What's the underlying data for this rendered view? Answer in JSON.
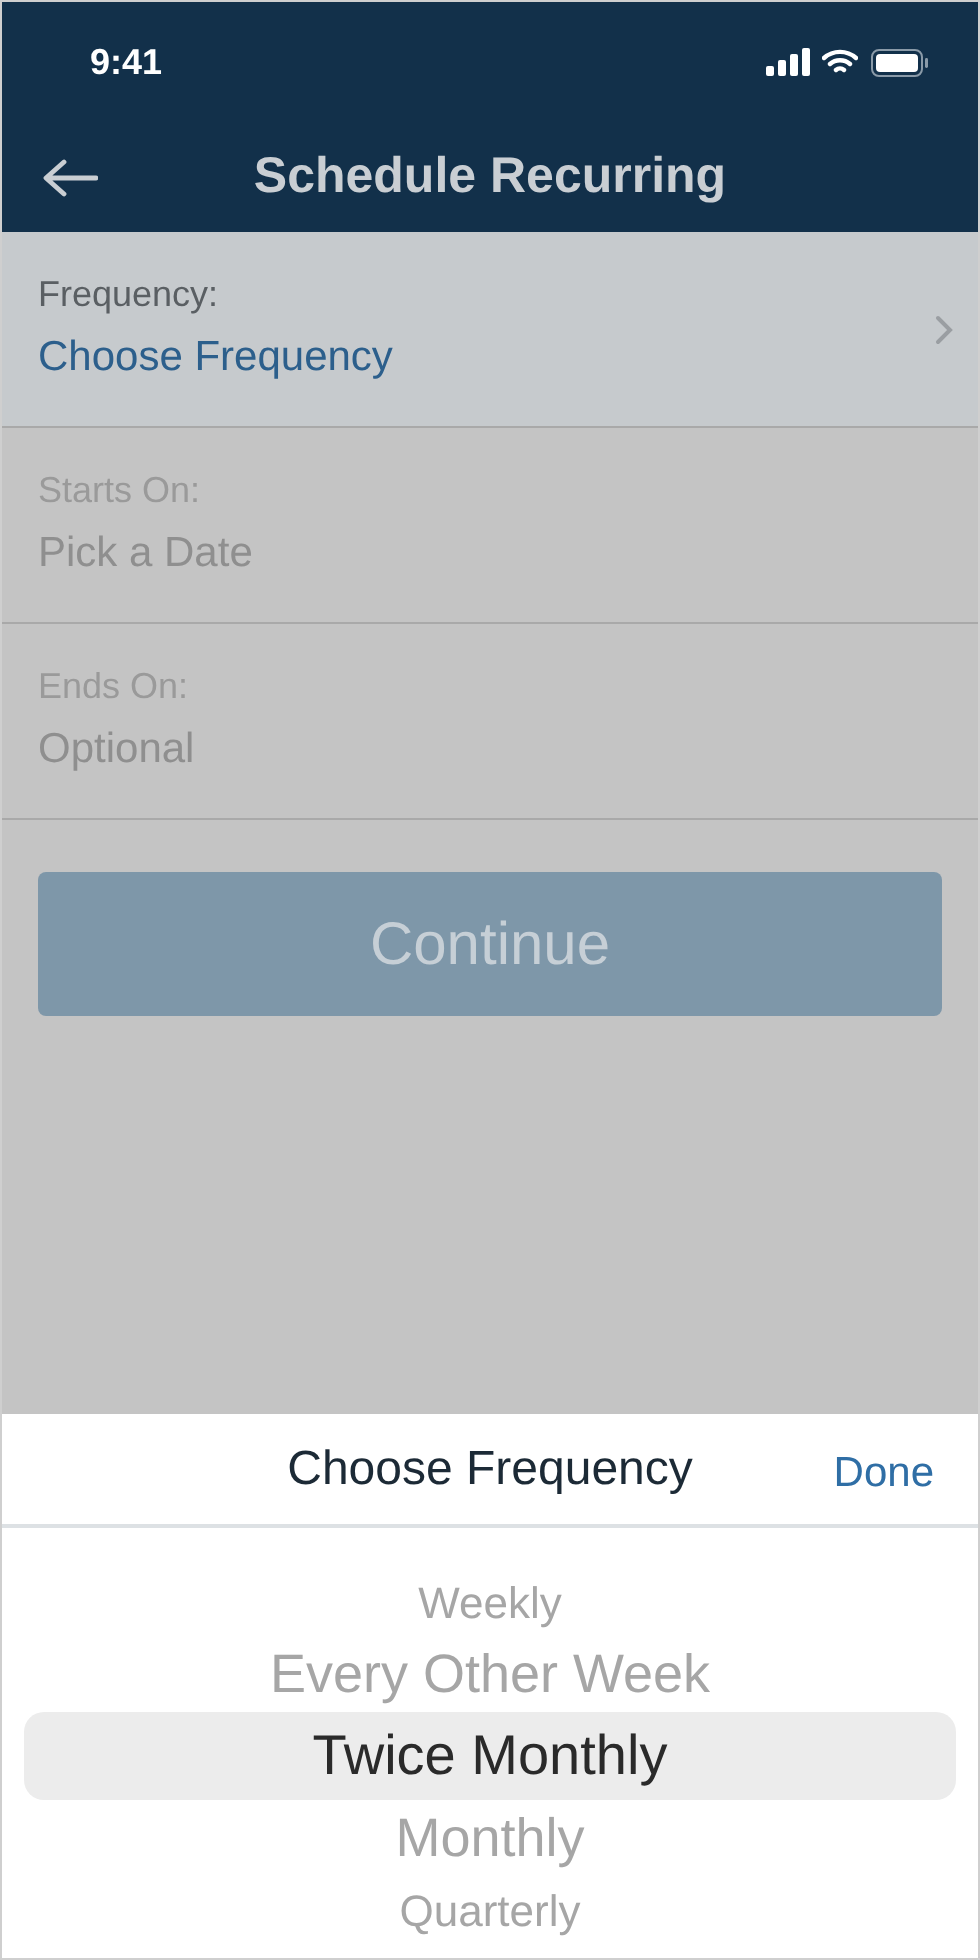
{
  "status_bar": {
    "time": "9:41"
  },
  "header": {
    "title": "Schedule Recurring"
  },
  "fields": [
    {
      "label": "Frequency:",
      "value": "Choose Frequency",
      "selected": true
    },
    {
      "label": "Starts On:",
      "placeholder": "Pick a Date",
      "selected": false
    },
    {
      "label": "Ends On:",
      "placeholder": "Optional",
      "selected": false
    }
  ],
  "continue_button": {
    "label": "Continue",
    "disabled": true
  },
  "picker": {
    "title": "Choose Frequency",
    "done": "Done",
    "options": [
      {
        "label": "Weekly",
        "selected": false
      },
      {
        "label": "Every Other Week",
        "selected": false
      },
      {
        "label": "Twice Monthly",
        "selected": true
      },
      {
        "label": "Monthly",
        "selected": false
      },
      {
        "label": "Quarterly",
        "selected": false
      }
    ]
  }
}
